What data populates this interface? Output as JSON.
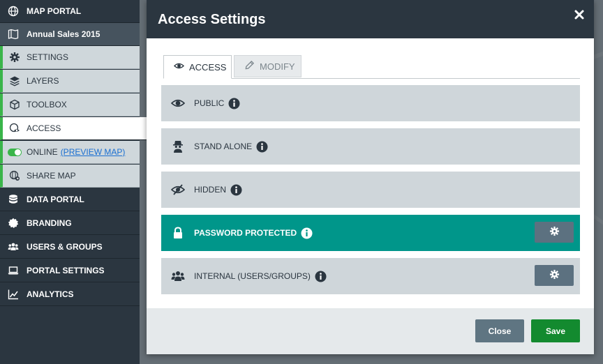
{
  "sidebar": {
    "items": [
      {
        "label": "MAP PORTAL",
        "icon": "globe-icon"
      },
      {
        "label": "Annual Sales 2015",
        "icon": "map-icon"
      },
      {
        "label": "SETTINGS",
        "icon": "gear-icon"
      },
      {
        "label": "LAYERS",
        "icon": "layers-icon"
      },
      {
        "label": "TOOLBOX",
        "icon": "cube-icon"
      },
      {
        "label": "ACCESS",
        "icon": "eye-globe-icon"
      },
      {
        "label": "ONLINE",
        "link": "(PREVIEW MAP)",
        "icon": "toggle-icon"
      },
      {
        "label": "SHARE MAP",
        "icon": "share-globe-icon"
      },
      {
        "label": "DATA PORTAL",
        "icon": "database-icon"
      },
      {
        "label": "BRANDING",
        "icon": "badge-icon"
      },
      {
        "label": "USERS & GROUPS",
        "icon": "users-icon"
      },
      {
        "label": "PORTAL SETTINGS",
        "icon": "laptop-icon"
      },
      {
        "label": "ANALYTICS",
        "icon": "chart-line-icon"
      }
    ]
  },
  "modal": {
    "title": "Access Settings",
    "tabs": [
      {
        "label": "ACCESS",
        "icon": "eye-icon",
        "active": true
      },
      {
        "label": "MODIFY",
        "icon": "pencil-icon",
        "active": false
      }
    ],
    "options": [
      {
        "label": "PUBLIC",
        "icon": "eye-icon",
        "selected": false
      },
      {
        "label": "STAND ALONE",
        "icon": "spy-icon",
        "selected": false
      },
      {
        "label": "HIDDEN",
        "icon": "eye-slash-icon",
        "selected": false
      },
      {
        "label": "PASSWORD PROTECTED",
        "icon": "lock-icon",
        "selected": true
      },
      {
        "label": "INTERNAL (USERS/GROUPS)",
        "icon": "users-icon",
        "selected": false
      }
    ],
    "footer": {
      "close_label": "Close",
      "save_label": "Save"
    }
  },
  "colors": {
    "sidebar_bg": "#2b3640",
    "accent_green": "#3ab54a",
    "selected_teal": "#00968a",
    "save_green": "#138a2f",
    "close_slate": "#5f7582"
  }
}
